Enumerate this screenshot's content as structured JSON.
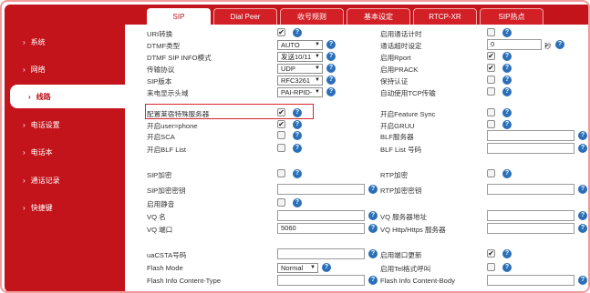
{
  "sidebar": {
    "items": [
      {
        "label": "系统"
      },
      {
        "label": "网络"
      },
      {
        "label": "线路"
      },
      {
        "label": "电话设置"
      },
      {
        "label": "电话本"
      },
      {
        "label": "通话记录"
      },
      {
        "label": "快捷键"
      }
    ],
    "active_index": 2
  },
  "tabs": [
    {
      "label": "SIP"
    },
    {
      "label": "Dial Peer"
    },
    {
      "label": "收号规则"
    },
    {
      "label": "基本设定"
    },
    {
      "label": "RTCP-XR"
    },
    {
      "label": "SIP热点"
    }
  ],
  "left": [
    {
      "label": "URI转换",
      "control": "checkbox",
      "checked": true
    },
    {
      "label": "DTMF类型",
      "control": "select",
      "value": "AUTO"
    },
    {
      "label": "DTMF SIP INFO模式",
      "control": "select",
      "value": "发送10/11"
    },
    {
      "label": "传输协议",
      "control": "select",
      "value": "UDP"
    },
    {
      "label": "SIP版本",
      "control": "select",
      "value": "RFC3261"
    },
    {
      "label": "来电显示头域",
      "control": "select",
      "value": "PAI-RPID-"
    },
    {
      "label": "配置莱宿特殊服务器",
      "control": "checkbox",
      "checked": true
    },
    {
      "label": "开启user=phone",
      "control": "checkbox",
      "checked": true
    },
    {
      "label": "开启SCA",
      "control": "checkbox",
      "checked": false
    },
    {
      "label": "开启BLF List",
      "control": "checkbox",
      "checked": false
    },
    {
      "label": "SIP加密",
      "control": "checkbox",
      "checked": false
    },
    {
      "label": "SIP加密密钥",
      "control": "input",
      "value": ""
    },
    {
      "label": "启用静音",
      "control": "checkbox",
      "checked": false
    },
    {
      "label": "VQ 名",
      "control": "input",
      "value": ""
    },
    {
      "label": "VQ 端口",
      "control": "input",
      "value": "5060"
    },
    {
      "label": "uaCSTA号码",
      "control": "input",
      "value": ""
    },
    {
      "label": "Flash Mode",
      "control": "select",
      "value": "Normal"
    },
    {
      "label": "Flash Info Content-Type",
      "control": "input",
      "value": ""
    }
  ],
  "right": [
    {
      "label": "启用通话计时",
      "control": "checkbox",
      "checked": false
    },
    {
      "label": "通话超时设定",
      "control": "input",
      "value": "0",
      "unit": "秒"
    },
    {
      "label": "启用Rport",
      "control": "checkbox",
      "checked": true
    },
    {
      "label": "启用PRACK",
      "control": "checkbox",
      "checked": true
    },
    {
      "label": "保持认证",
      "control": "checkbox",
      "checked": false
    },
    {
      "label": "自动使用TCP传输",
      "control": "checkbox",
      "checked": false
    },
    {
      "label": "开启Feature Sync",
      "control": "checkbox",
      "checked": false
    },
    {
      "label": "开启GRUU",
      "control": "checkbox",
      "checked": false
    },
    {
      "label": "BLF服务器",
      "control": "input",
      "value": ""
    },
    {
      "label": "BLF List 号码",
      "control": "input",
      "value": ""
    },
    {
      "label": "RTP加密",
      "control": "checkbox",
      "checked": false
    },
    {
      "label": "RTP加密密钥",
      "control": "input",
      "value": ""
    },
    {
      "label": "VQ 服务器地址",
      "control": "input",
      "value": ""
    },
    {
      "label": "VQ Http/Https 服务器",
      "control": "input",
      "value": ""
    },
    {
      "label": "启用端口更新",
      "control": "checkbox",
      "checked": true
    },
    {
      "label": "启用Tel格式呼叫",
      "control": "checkbox",
      "checked": false
    },
    {
      "label": "Flash Info Content-Body",
      "control": "input",
      "value": ""
    }
  ],
  "icons": {
    "help": "help-icon",
    "checkmark": "✔",
    "dropdown": "▼",
    "chevron": "›"
  },
  "colors": {
    "brand_red": "#c4141b",
    "help_blue": "#2a6fb8",
    "highlight_red": "#d8242b"
  }
}
